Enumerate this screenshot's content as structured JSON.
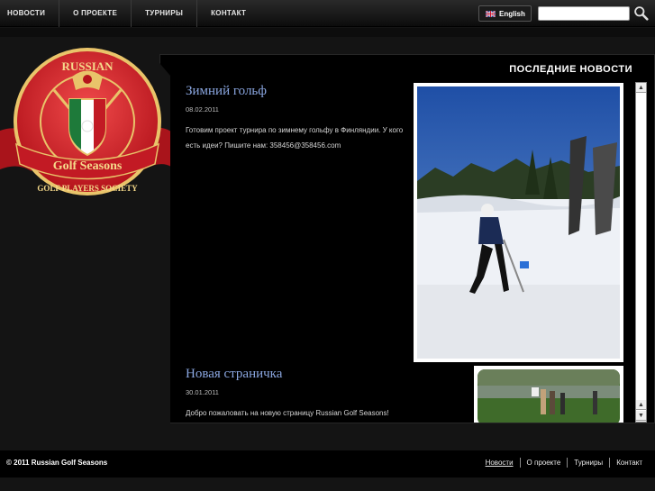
{
  "nav": {
    "items": [
      {
        "label": "НОВОСТИ"
      },
      {
        "label": "О ПРОЕКТЕ"
      },
      {
        "label": "ТУРНИРЫ"
      },
      {
        "label": "КОНТАКТ"
      }
    ],
    "language_button": "English",
    "search_placeholder": ""
  },
  "logo": {
    "top_text": "RUSSIAN",
    "banner_text": "Golf Seasons",
    "bottom_text": "GOLF PLAYERS SOCIETY"
  },
  "panel": {
    "heading": "ПОСЛЕДНИЕ НОВОСТИ",
    "news": [
      {
        "title": "Зимний гольф",
        "date": "08.02.2011",
        "body": "Готовим проект турнира по зимнему гольфу в Финляндии. У кого есть идеи? Пишите нам: 358456@358456.com"
      },
      {
        "title": "Новая страничка",
        "date": "30.01.2011",
        "body": "Добро пожаловать на новую страницу Russian Golf Seasons! Смотрите,"
      }
    ]
  },
  "footer": {
    "copyright": "© 2011 Russian Golf Seasons",
    "links": [
      {
        "label": "Новости"
      },
      {
        "label": "О проекте"
      },
      {
        "label": "Турниры"
      },
      {
        "label": "Контакт"
      }
    ]
  },
  "colors": {
    "accent_title": "#8aa6e0",
    "logo_red": "#d8232a",
    "logo_gold": "#e9c46a"
  }
}
